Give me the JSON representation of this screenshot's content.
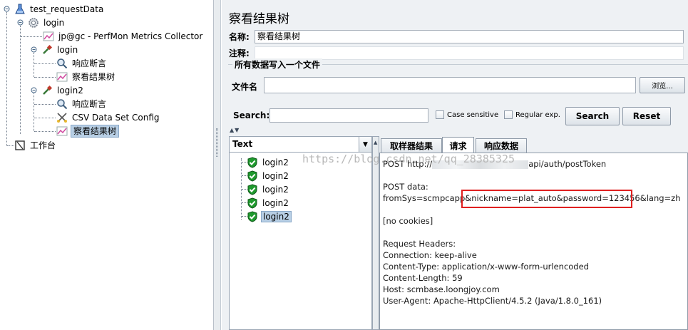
{
  "tree": {
    "root": "test_requestData",
    "thread_group": "login",
    "perfmon": "jp@gc - PerfMon Metrics Collector",
    "sampler1": "login",
    "assert1": "响应断言",
    "listener1": "察看结果树",
    "sampler2": "login2",
    "assert2": "响应断言",
    "csv": "CSV Data Set Config",
    "listener2": "察看结果树",
    "workbench": "工作台"
  },
  "panel": {
    "title": "察看结果树",
    "name_label": "名称:",
    "name_value": "察看结果树",
    "comment_label": "注释:",
    "comment_value": "",
    "file_group_title": "所有数据写入一个文件",
    "file_label": "文件名",
    "file_value": "",
    "browse_label": "浏览..."
  },
  "search": {
    "label": "Search:",
    "value": "",
    "case_sensitive": "Case sensitive",
    "regular_exp": "Regular exp.",
    "search_button": "Search",
    "reset_button": "Reset"
  },
  "results": {
    "renderer": "Text",
    "items": [
      "login2",
      "login2",
      "login2",
      "login2",
      "login2"
    ],
    "selected_index": 4
  },
  "tabs": {
    "sampler_result": "取样器结果",
    "request": "请求",
    "response_data": "响应数据",
    "active": "请求"
  },
  "request": {
    "line1_prefix": "POST http://",
    "line1_suffix": "api/auth/postToken",
    "post_data_label": "POST data:",
    "post_body_a": "fromSys=scmpcapp",
    "post_body_b": "&nickname=plat_auto&password=123456",
    "post_body_c": "&lang=zh",
    "cookies": "[no cookies]",
    "headers_title": "Request Headers:",
    "h_connection": "Connection: keep-alive",
    "h_content_type": "Content-Type: application/x-www-form-urlencoded",
    "h_content_length": "Content-Length: 59",
    "h_host": "Host: scmbase.loongjoy.com",
    "h_user_agent": "User-Agent: Apache-HttpClient/4.5.2 (Java/1.8.0_161)"
  },
  "watermark": "https://blog.csdn.net/qq_28385325",
  "colors": {
    "selection": "#b8cfe5",
    "highlight_box": "#e02020",
    "pass_icon": "#1f9a2e"
  }
}
